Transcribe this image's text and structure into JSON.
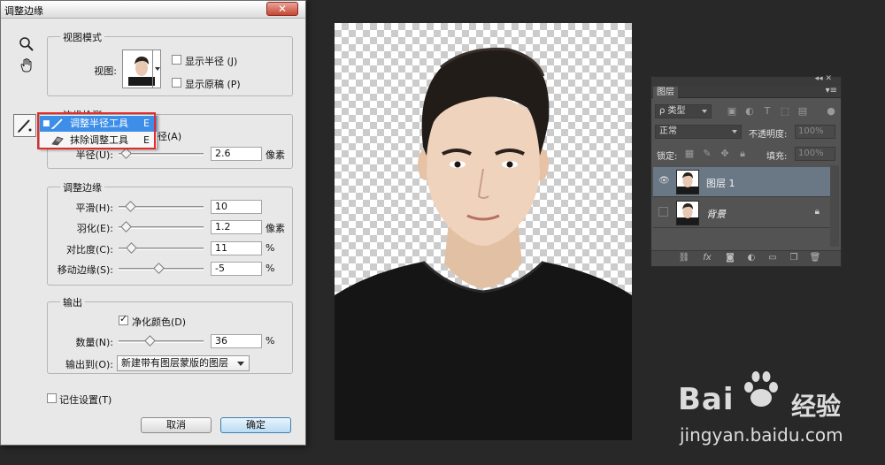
{
  "dialog": {
    "title": "调整边缘",
    "close_label": "✕",
    "view_mode": {
      "group_title": "视图模式",
      "view_label": "视图:",
      "show_radius": "显示半径 (J)",
      "show_original": "显示原稿 (P)"
    },
    "edge_detection": {
      "group_title": "边缘检测",
      "smart_radius_tail": "径(A)",
      "radius_label": "半径(U):",
      "radius_value": "2.6",
      "radius_unit": "像素",
      "radius_pos": 0.05
    },
    "adjust_edge": {
      "group_title": "调整边缘",
      "smooth_label": "平滑(H):",
      "smooth_value": "10",
      "smooth_pos": 0.1,
      "feather_label": "羽化(E):",
      "feather_value": "1.2",
      "feather_unit": "像素",
      "feather_pos": 0.05,
      "contrast_label": "对比度(C):",
      "contrast_value": "11",
      "contrast_unit": "%",
      "contrast_pos": 0.11,
      "shift_label": "移动边缘(S):",
      "shift_value": "-5",
      "shift_unit": "%",
      "shift_pos": 0.47
    },
    "output": {
      "group_title": "输出",
      "decontaminate_label": "净化颜色(D)",
      "amount_label": "数量(N):",
      "amount_value": "36",
      "amount_unit": "%",
      "amount_pos": 0.36,
      "output_to_label": "输出到(O):",
      "output_to_value": "新建带有图层蒙版的图层"
    },
    "remember_label": "记住设置(T)",
    "cancel_label": "取消",
    "ok_label": "确定"
  },
  "flyout": {
    "items": [
      {
        "label": "调整半径工具",
        "key": "E",
        "selected": true
      },
      {
        "label": "抹除调整工具",
        "key": "E",
        "selected": false
      }
    ]
  },
  "layers_panel": {
    "tab": "图层",
    "filter_label": "ρ 类型",
    "blend_mode": "正常",
    "opacity_label": "不透明度:",
    "opacity_value": "100%",
    "lock_label": "锁定:",
    "fill_label": "填充:",
    "fill_value": "100%",
    "layers": [
      {
        "name": "图层 1",
        "active": true
      },
      {
        "name": "背景",
        "active": false
      }
    ]
  },
  "watermark": {
    "brand_latin": "Bai",
    "brand_cn": "经验",
    "url": "jingyan.baidu.com"
  }
}
